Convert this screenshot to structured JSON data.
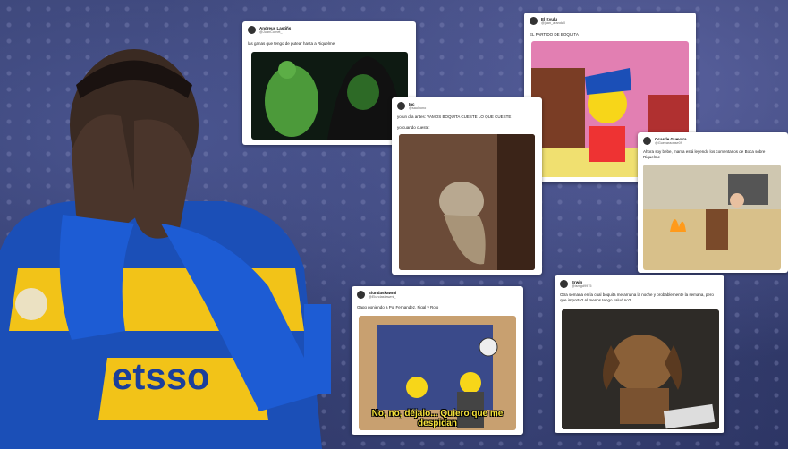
{
  "tweets": [
    {
      "name": "Andreus Lastiñs",
      "handle": "@JuanCornet_",
      "text": "las ganas que tengo de putear hasta a Riquelme"
    },
    {
      "name": "Inc",
      "handle": "@saulnono",
      "text": "yo un día antes: VAMOS BOQUITA CUESTE LO QUE CUESTE",
      "text2": "yo cuando cueste:"
    },
    {
      "name": "El Kyulu",
      "handle": "@juan_aranda0",
      "text": "EL PARTIDO DE BOQUITA"
    },
    {
      "name": "Ocastle Guevara",
      "handle": "@Guevaraouse09",
      "text": "Ahora soy bebe, mama está leyendo los comentarios de Boca sobre Riquelme"
    },
    {
      "name": "Elundaskawmi",
      "handle": "@Elundaskawmi_",
      "text": "Gago poniendo a Pol Fernandez, Figal y Rojo",
      "caption": "No, no, déjalo... Quiero que me despidan"
    },
    {
      "name": "Erwin",
      "handle": "@ismgd9975",
      "text": "Otra semana en la cual boquita me arruina la noche y probablemente la semana, pero que importa? Al menos tengo salud no?"
    }
  ],
  "jersey_sponsor": "etsso",
  "colors": {
    "boca_blue": "#1b4fb7",
    "boca_gold": "#f2c318"
  }
}
